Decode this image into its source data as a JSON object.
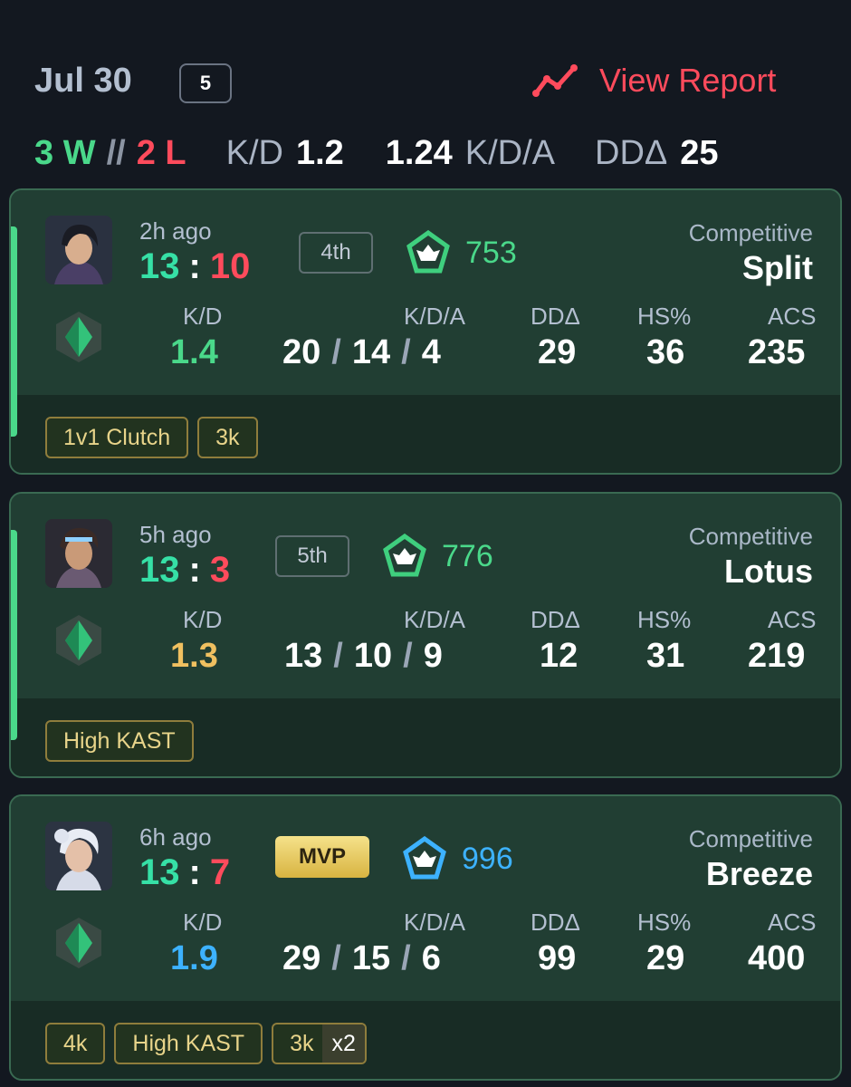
{
  "header": {
    "date": "Jul 30",
    "match_count": "5",
    "view_report_label": "View Report"
  },
  "summary": {
    "wins": "3 W",
    "separator": "//",
    "losses": "2 L",
    "kd_label": "K/D",
    "kd_value": "1.2",
    "kda_value": "1.24",
    "kda_label": "K/D/A",
    "dd_label": "DDΔ",
    "dd_value": "25"
  },
  "colors": {
    "win": "#4ad88a",
    "loss": "#ff4b5c",
    "accent_red": "#ff4b5c",
    "kd_green": "#4ad88a",
    "kd_gold": "#f0c060",
    "kd_blue": "#3db2ff",
    "tag_gold": "#e8d48a"
  },
  "stat_labels": {
    "kd": "K/D",
    "kda": "K/D/A",
    "dd": "DDΔ",
    "hs": "HS%",
    "acs": "ACS"
  },
  "matches": [
    {
      "ago": "2h ago",
      "score_own": "13",
      "score_colon": ":",
      "score_opp": "10",
      "placement": "4th",
      "rr": "753",
      "mode": "Competitive",
      "map": "Split",
      "kd": "1.4",
      "kills": "20",
      "deaths": "14",
      "assists": "4",
      "dd": "29",
      "hs": "36",
      "acs": "235",
      "tags": [
        "1v1 Clutch",
        "3k"
      ]
    },
    {
      "ago": "5h ago",
      "score_own": "13",
      "score_colon": ":",
      "score_opp": "3",
      "placement": "5th",
      "rr": "776",
      "mode": "Competitive",
      "map": "Lotus",
      "kd": "1.3",
      "kills": "13",
      "deaths": "10",
      "assists": "9",
      "dd": "12",
      "hs": "31",
      "acs": "219",
      "tags": [
        "High KAST"
      ]
    },
    {
      "ago": "6h ago",
      "score_own": "13",
      "score_colon": ":",
      "score_opp": "7",
      "placement": "MVP",
      "rr": "996",
      "mode": "Competitive",
      "map": "Breeze",
      "kd": "1.9",
      "kills": "29",
      "deaths": "15",
      "assists": "6",
      "dd": "99",
      "hs": "29",
      "acs": "400",
      "tags": [
        "4k",
        "High KAST",
        "3k"
      ],
      "tag_multiplier": "x2"
    }
  ]
}
